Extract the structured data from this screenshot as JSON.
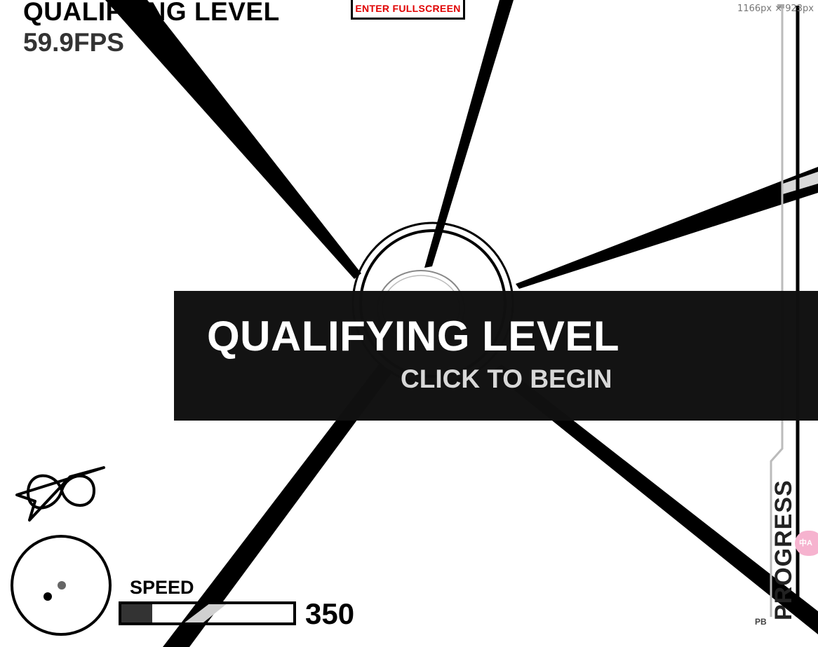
{
  "hud": {
    "level_title": "QUALIFYING LEVEL",
    "fps": "59.9FPS",
    "fullscreen_label": "ENTER FULLSCREEN",
    "dimensions": "1166px × 923px"
  },
  "overlay": {
    "title": "QUALIFYING LEVEL",
    "subtitle": "CLICK TO BEGIN"
  },
  "speed": {
    "label": "SPEED",
    "value": "350",
    "fill_fraction": 0.18
  },
  "progress": {
    "label": "PROGRESS",
    "pb_label": "PB"
  },
  "extension": {
    "translate_badge": "中A"
  },
  "colors": {
    "background": "#ffffff",
    "ink": "#000000",
    "banner": "#101010",
    "fullscreen_text": "#e00000",
    "badge": "#f6b3cf"
  },
  "icons": {
    "logo": "infinity-ship-logo-icon",
    "radar": "radar-minimap-icon"
  }
}
